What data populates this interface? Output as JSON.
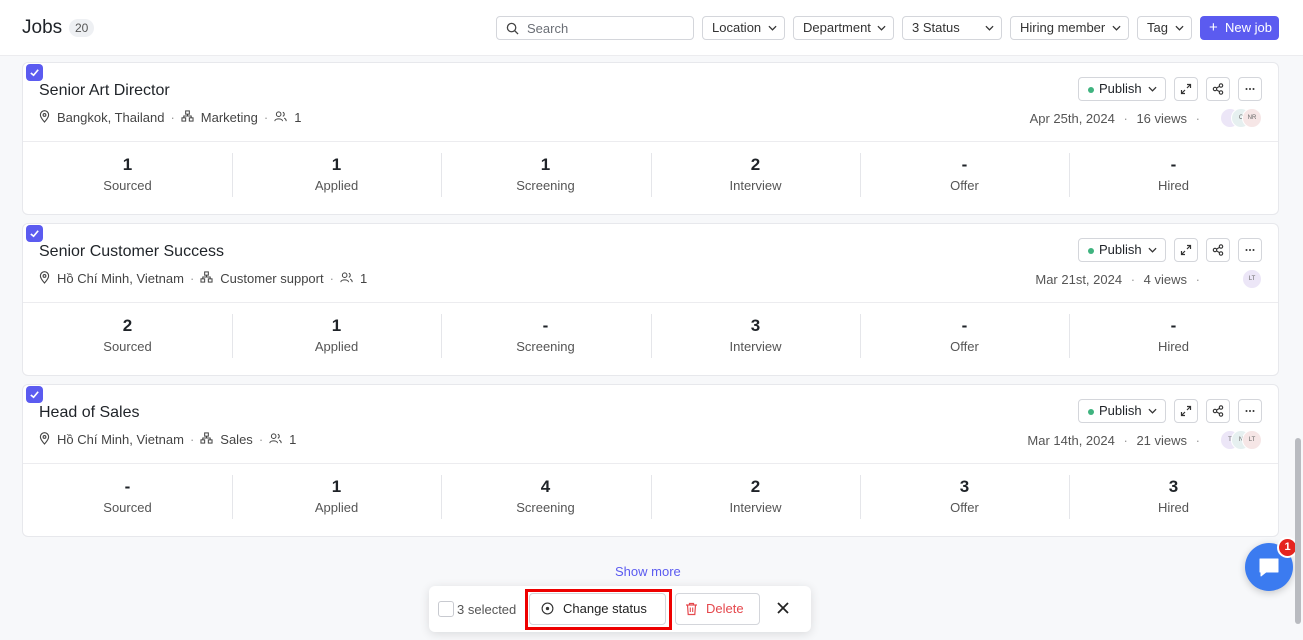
{
  "header": {
    "title": "Jobs",
    "count": "20",
    "search_placeholder": "Search",
    "filters": [
      "Location",
      "Department",
      "3 Status",
      "Hiring member",
      "Tag"
    ],
    "new_job_label": "New job",
    "new_job_icon": "plus-icon"
  },
  "stat_labels": [
    "Sourced",
    "Applied",
    "Screening",
    "Interview",
    "Offer",
    "Hired"
  ],
  "jobs": [
    {
      "title": "Senior Art Director",
      "location": "Bangkok, Thailand",
      "department": "Marketing",
      "members": "1",
      "status": "Publish",
      "date": "Apr 25th, 2024",
      "views": "16 views",
      "avatars": [
        "",
        "C",
        "NR"
      ],
      "stats": [
        "1",
        "1",
        "1",
        "2",
        "-",
        "-"
      ]
    },
    {
      "title": "Senior Customer Success",
      "location": "Hồ Chí Minh, Vietnam",
      "department": "Customer support",
      "members": "1",
      "status": "Publish",
      "date": "Mar 21st, 2024",
      "views": "4 views",
      "avatars": [
        "LT"
      ],
      "stats": [
        "2",
        "1",
        "-",
        "3",
        "-",
        "-"
      ]
    },
    {
      "title": "Head of Sales",
      "location": "Hồ Chí Minh, Vietnam",
      "department": "Sales",
      "members": "1",
      "status": "Publish",
      "date": "Mar 14th, 2024",
      "views": "21 views",
      "avatars": [
        "T",
        "N",
        "LT"
      ],
      "stats": [
        "-",
        "1",
        "4",
        "2",
        "3",
        "3"
      ]
    }
  ],
  "show_more": "Show more",
  "bulk": {
    "selected_text": "3 selected",
    "change_status": "Change status",
    "delete": "Delete"
  },
  "chat_badge": "1",
  "colors": {
    "accent": "#5b5bf0",
    "publish_dot": "#3fb37f",
    "delete": "#e5484d",
    "highlight": "#ee0000",
    "chat": "#3b7bf0"
  }
}
